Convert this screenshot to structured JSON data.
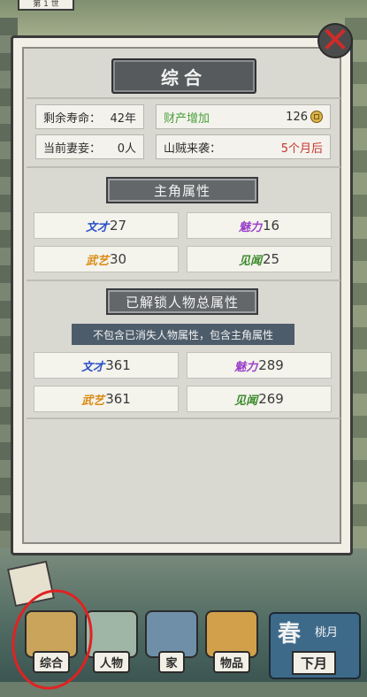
{
  "top": {
    "tab_text": "第 1 世"
  },
  "panel": {
    "title": "综合",
    "info": [
      {
        "label": "剩余寿命：",
        "value": "42年"
      },
      {
        "label": "财产增加",
        "value": "126"
      },
      {
        "label": "当前妻妾：",
        "value": "0人"
      },
      {
        "label": "山贼来袭：",
        "value": "5个月后"
      }
    ],
    "hero_section": {
      "title": "主角属性",
      "attrs": [
        {
          "tag": "文才",
          "value": "27",
          "color": "#2a50c8"
        },
        {
          "tag": "魅力",
          "value": "16",
          "color": "#9a3fc8"
        },
        {
          "tag": "武艺",
          "value": "30",
          "color": "#d98a12"
        },
        {
          "tag": "见闻",
          "value": "25",
          "color": "#3a8a2a"
        }
      ]
    },
    "total_section": {
      "title": "已解锁人物总属性",
      "note": "不包含已消失人物属性，包含主角属性",
      "attrs": [
        {
          "tag": "文才",
          "value": "361",
          "color": "#2a50c8"
        },
        {
          "tag": "魅力",
          "value": "289",
          "color": "#9a3fc8"
        },
        {
          "tag": "武艺",
          "value": "361",
          "color": "#d98a12"
        },
        {
          "tag": "见闻",
          "value": "269",
          "color": "#3a8a2a"
        }
      ]
    }
  },
  "nav": {
    "items": [
      {
        "label": "综合",
        "icon": "cart-icon",
        "color": "#c9a45a"
      },
      {
        "label": "人物",
        "icon": "person-icon",
        "color": "#9fb5a5"
      },
      {
        "label": "家",
        "icon": "house-icon",
        "color": "#6f8fa8"
      },
      {
        "label": "物品",
        "icon": "gourd-icon",
        "color": "#d2a04a"
      }
    ],
    "season": {
      "big": "春",
      "small": "桃月",
      "next": "下月"
    }
  }
}
